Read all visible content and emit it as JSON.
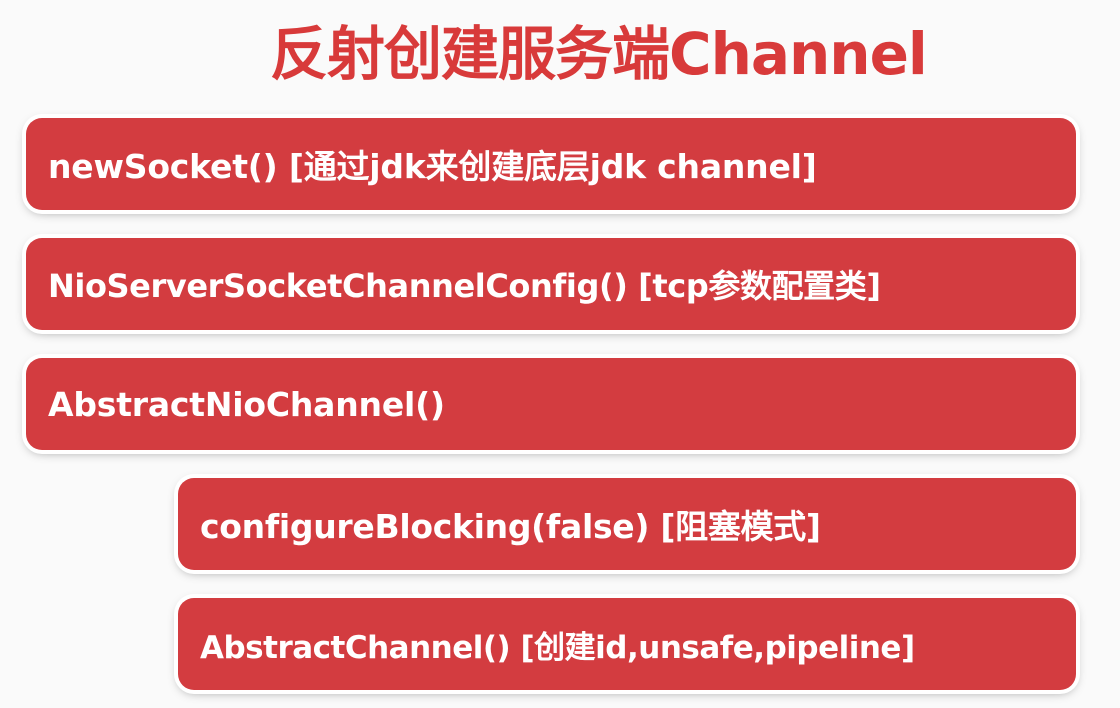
{
  "title": "反射创建服务端Channel",
  "steps": [
    {
      "label": "newSocket() [通过jdk来创建底层jdk channel]"
    },
    {
      "label": "NioServerSocketChannelConfig() [tcp参数配置类]"
    },
    {
      "label": "AbstractNioChannel()"
    },
    {
      "label": "configureBlocking(false) [阻塞模式]"
    },
    {
      "label": "AbstractChannel() [创建id,unsafe,pipeline]"
    }
  ],
  "colors": {
    "title": "#d83a3a",
    "box_fill": "#d33c40",
    "box_text": "#ffffff",
    "background": "#fafafa"
  }
}
